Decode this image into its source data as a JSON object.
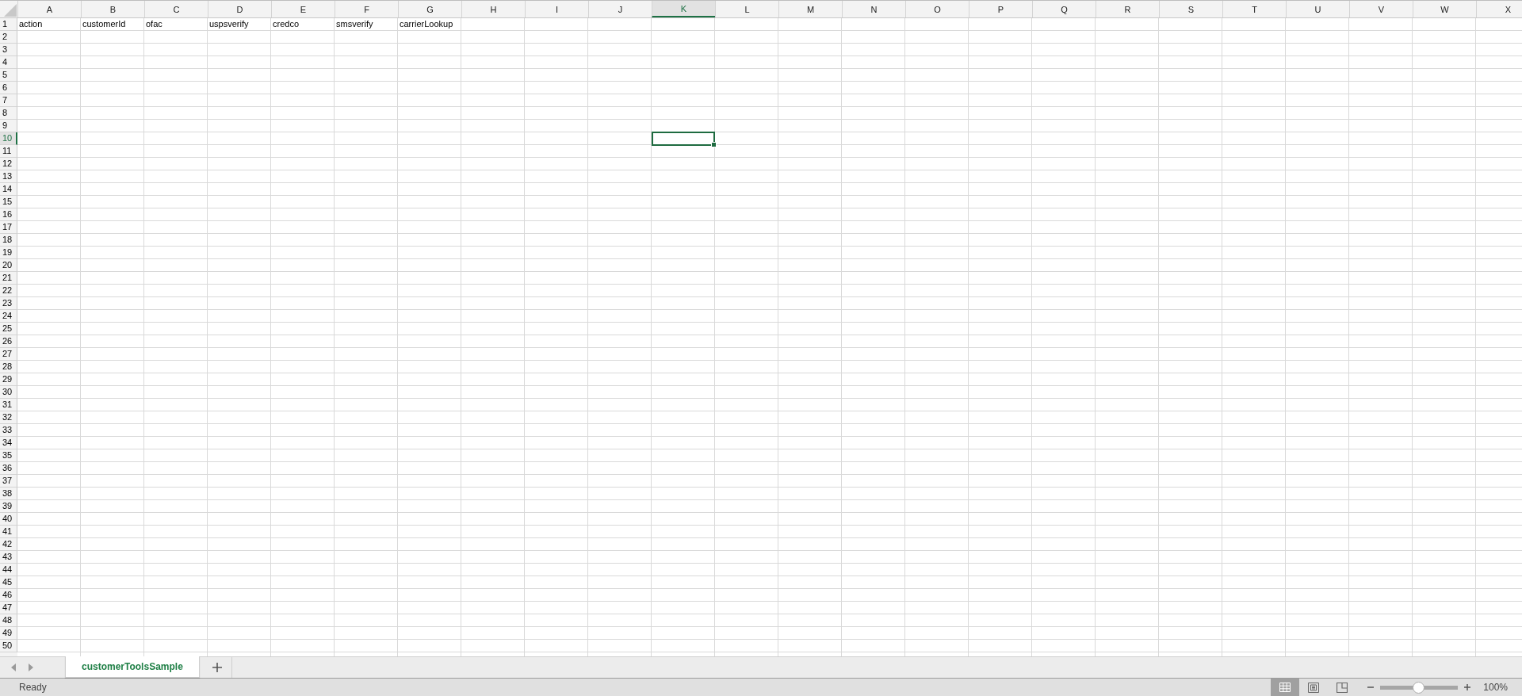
{
  "columns": [
    {
      "label": "A",
      "selected": false
    },
    {
      "label": "B",
      "selected": false
    },
    {
      "label": "C",
      "selected": false
    },
    {
      "label": "D",
      "selected": false
    },
    {
      "label": "E",
      "selected": false
    },
    {
      "label": "F",
      "selected": false
    },
    {
      "label": "G",
      "selected": false
    },
    {
      "label": "H",
      "selected": false
    },
    {
      "label": "I",
      "selected": false
    },
    {
      "label": "J",
      "selected": false
    },
    {
      "label": "K",
      "selected": true
    },
    {
      "label": "L",
      "selected": false
    },
    {
      "label": "M",
      "selected": false
    },
    {
      "label": "N",
      "selected": false
    },
    {
      "label": "O",
      "selected": false
    },
    {
      "label": "P",
      "selected": false
    },
    {
      "label": "Q",
      "selected": false
    },
    {
      "label": "R",
      "selected": false
    },
    {
      "label": "S",
      "selected": false
    },
    {
      "label": "T",
      "selected": false
    },
    {
      "label": "U",
      "selected": false
    },
    {
      "label": "V",
      "selected": false
    },
    {
      "label": "W",
      "selected": false
    },
    {
      "label": "X",
      "selected": false
    }
  ],
  "rows": [
    {
      "label": "1",
      "selected": false,
      "cells": [
        "action",
        "customerId",
        "ofac",
        "uspsverify",
        "credco",
        "smsverify",
        "carrierLookup"
      ]
    },
    {
      "label": "2",
      "selected": false
    },
    {
      "label": "3",
      "selected": false
    },
    {
      "label": "4",
      "selected": false
    },
    {
      "label": "5",
      "selected": false
    },
    {
      "label": "6",
      "selected": false
    },
    {
      "label": "7",
      "selected": false
    },
    {
      "label": "8",
      "selected": false
    },
    {
      "label": "9",
      "selected": false
    },
    {
      "label": "10",
      "selected": true
    },
    {
      "label": "11",
      "selected": false
    },
    {
      "label": "12",
      "selected": false
    },
    {
      "label": "13",
      "selected": false
    },
    {
      "label": "14",
      "selected": false
    },
    {
      "label": "15",
      "selected": false
    },
    {
      "label": "16",
      "selected": false
    },
    {
      "label": "17",
      "selected": false
    },
    {
      "label": "18",
      "selected": false
    },
    {
      "label": "19",
      "selected": false
    },
    {
      "label": "20",
      "selected": false
    },
    {
      "label": "21",
      "selected": false
    },
    {
      "label": "22",
      "selected": false
    },
    {
      "label": "23",
      "selected": false
    },
    {
      "label": "24",
      "selected": false
    },
    {
      "label": "25",
      "selected": false
    },
    {
      "label": "26",
      "selected": false
    },
    {
      "label": "27",
      "selected": false
    },
    {
      "label": "28",
      "selected": false
    },
    {
      "label": "29",
      "selected": false
    },
    {
      "label": "30",
      "selected": false
    },
    {
      "label": "31",
      "selected": false
    },
    {
      "label": "32",
      "selected": false
    },
    {
      "label": "33",
      "selected": false
    },
    {
      "label": "34",
      "selected": false
    },
    {
      "label": "35",
      "selected": false
    },
    {
      "label": "36",
      "selected": false
    },
    {
      "label": "37",
      "selected": false
    },
    {
      "label": "38",
      "selected": false
    },
    {
      "label": "39",
      "selected": false
    },
    {
      "label": "40",
      "selected": false
    },
    {
      "label": "41",
      "selected": false
    },
    {
      "label": "42",
      "selected": false
    },
    {
      "label": "43",
      "selected": false
    },
    {
      "label": "44",
      "selected": false
    },
    {
      "label": "45",
      "selected": false
    },
    {
      "label": "46",
      "selected": false
    },
    {
      "label": "47",
      "selected": false
    },
    {
      "label": "48",
      "selected": false
    },
    {
      "label": "49",
      "selected": false
    },
    {
      "label": "50",
      "selected": false
    }
  ],
  "sheet_tabs": [
    {
      "label": "customerToolsSample",
      "selected": true
    }
  ],
  "status_bar": {
    "status": "Ready",
    "view_buttons": [
      {
        "kind": "normal",
        "selected": true
      },
      {
        "kind": "page-layout",
        "selected": false
      },
      {
        "kind": "page-break",
        "selected": false
      }
    ],
    "zoom": {
      "level": 0.5,
      "reading": "100%"
    }
  }
}
